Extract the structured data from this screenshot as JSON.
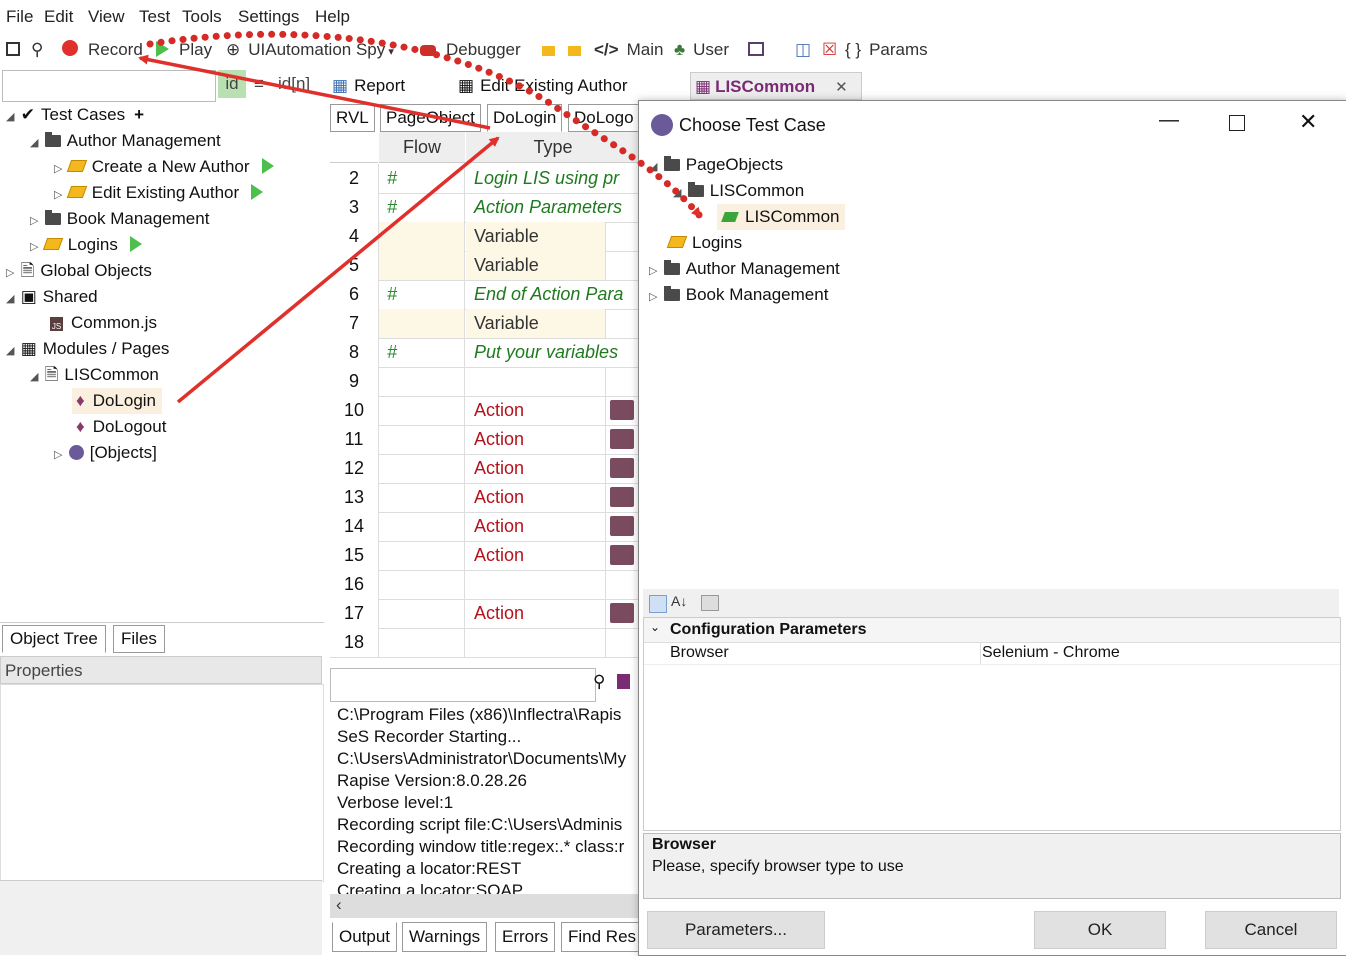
{
  "menu": [
    "File",
    "Edit",
    "View",
    "Test",
    "Tools",
    "Settings",
    "Help"
  ],
  "toolbar": {
    "record": "Record",
    "play": "Play",
    "spy": "UIAutomation Spy",
    "debugger": "Debugger",
    "main": "Main",
    "user": "User",
    "params": "Params"
  },
  "left_tabs_top": {
    "id": "id",
    "idn": "id[n]"
  },
  "tree": {
    "test_cases": "Test Cases",
    "author_management": "Author Management",
    "create_author": "Create a New Author",
    "edit_author": "Edit Existing Author",
    "book_management": "Book Management",
    "logins": "Logins",
    "global_objects": "Global Objects",
    "shared": "Shared",
    "common_js": "Common.js",
    "modules_pages": "Modules / Pages",
    "liscommon": "LISCommon",
    "dologin": "DoLogin",
    "dologout": "DoLogout",
    "objects": "[Objects]"
  },
  "left_bottom_tabs": [
    "Object Tree",
    "Files"
  ],
  "properties_label": "Properties",
  "doc_tabs": {
    "report": "Report",
    "edit_existing": "Edit Existing Author",
    "liscommon": "LISCommon"
  },
  "sub_tabs": [
    "RVL",
    "PageObject",
    "DoLogin",
    "DoLogo"
  ],
  "grid_headers": {
    "flow": "Flow",
    "type": "Type"
  },
  "grid_rows": [
    {
      "n": "2",
      "flow": "#",
      "type": "Login LIS using pr",
      "style": "green"
    },
    {
      "n": "3",
      "flow": "#",
      "type": "Action Parameters",
      "style": "green"
    },
    {
      "n": "4",
      "flow": "",
      "type": "Variable",
      "style": "var"
    },
    {
      "n": "5",
      "flow": "",
      "type": "Variable",
      "style": "var"
    },
    {
      "n": "6",
      "flow": "#",
      "type": "End of Action Para",
      "style": "green"
    },
    {
      "n": "7",
      "flow": "",
      "type": "Variable",
      "style": "var"
    },
    {
      "n": "8",
      "flow": "#",
      "type": "Put your variables",
      "style": "green"
    },
    {
      "n": "9",
      "flow": "",
      "type": "",
      "style": "none"
    },
    {
      "n": "10",
      "flow": "",
      "type": "Action",
      "style": "red"
    },
    {
      "n": "11",
      "flow": "",
      "type": "Action",
      "style": "red"
    },
    {
      "n": "12",
      "flow": "",
      "type": "Action",
      "style": "red"
    },
    {
      "n": "13",
      "flow": "",
      "type": "Action",
      "style": "red"
    },
    {
      "n": "14",
      "flow": "",
      "type": "Action",
      "style": "red"
    },
    {
      "n": "15",
      "flow": "",
      "type": "Action",
      "style": "red"
    },
    {
      "n": "16",
      "flow": "",
      "type": "",
      "style": "none"
    },
    {
      "n": "17",
      "flow": "",
      "type": "Action",
      "style": "red"
    },
    {
      "n": "18",
      "flow": "",
      "type": "",
      "style": "none"
    }
  ],
  "output_lines": [
    "C:\\Program Files (x86)\\Inflectra\\Rapis",
    "SeS Recorder Starting...",
    "C:\\Users\\Administrator\\Documents\\My",
    "Rapise Version:8.0.28.26",
    "Verbose level:1",
    "Recording script file:C:\\Users\\Adminis",
    "Recording window title:regex:.* class:r",
    "Creating a locator:REST",
    "Creating a locator:SOAP"
  ],
  "output_tabs": [
    "Output",
    "Warnings",
    "Errors",
    "Find Res"
  ],
  "dialog": {
    "title": "Choose Test Case",
    "tree": {
      "pageobjects": "PageObjects",
      "liscommon_folder": "LISCommon",
      "liscommon_item": "LISCommon",
      "logins": "Logins",
      "author_management": "Author Management",
      "book_management": "Book Management"
    },
    "grid": {
      "section": "Configuration Parameters",
      "prop_name": "Browser",
      "prop_value": "Selenium - Chrome"
    },
    "help": {
      "title": "Browser",
      "text": "Please, specify browser type to use"
    },
    "buttons": {
      "parameters": "Parameters...",
      "ok": "OK",
      "cancel": "Cancel"
    }
  },
  "colors": {
    "accent_red": "#e0302b",
    "selection": "#fbf0df",
    "liscommon_tab": "#7a2b74"
  }
}
